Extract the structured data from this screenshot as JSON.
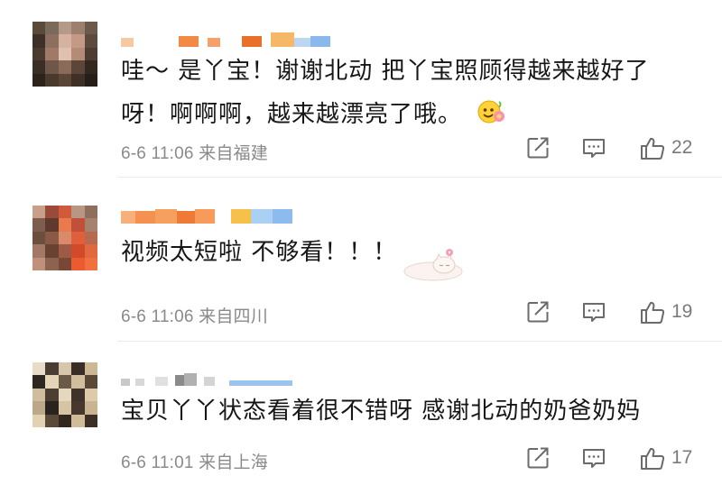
{
  "comments": [
    {
      "text_line1": "哇～ 是丫宝！谢谢北动 把丫宝照顾得越来越好了",
      "text_line2": "呀！啊啊啊，越来越漂亮了哦。",
      "meta": "6-6 11:06 来自福建",
      "likes": "22",
      "emoji": "smiling-flower-emoji"
    },
    {
      "text_line1": "视频太短啦 不够看！！！",
      "meta": "6-6 11:06 来自四川",
      "likes": "19",
      "sticker": "sleeping-cat-sticker"
    },
    {
      "text_line1": "宝贝丫丫状态看着很不错呀 感谢北动的奶爸奶妈",
      "meta": "6-6 11:01 来自上海",
      "likes": "17"
    }
  ],
  "icons": {
    "share": "share-icon",
    "comment": "comment-icon",
    "like": "thumbs-up-icon"
  },
  "colors": {
    "text": "#161616",
    "meta": "#8a8a8a",
    "icon": "#6b6b6b"
  }
}
